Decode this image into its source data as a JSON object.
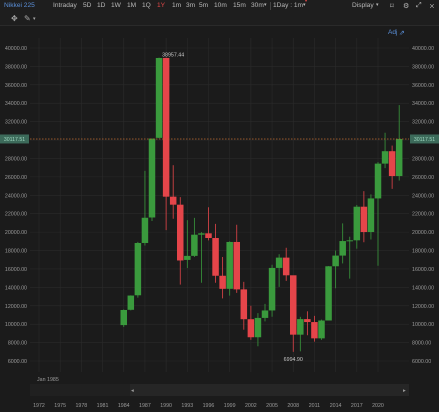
{
  "toolbar": {
    "symbol": "Nikkei 225",
    "intervals": [
      "Intraday",
      "5D",
      "1D",
      "1W",
      "1M",
      "1Q",
      "1Y",
      "1m",
      "3m",
      "5m",
      "10m",
      "15m",
      "30m"
    ],
    "active_interval": "1Y",
    "interval_dropdown": "1Day : 1m",
    "display_label": "Display",
    "adj_label": "Adj",
    "icons": [
      "dropdown-chevron-icon",
      "camera-icon",
      "settings-icon",
      "expand-icon",
      "close-icon",
      "crosshair-icon",
      "draw-icon"
    ]
  },
  "chart": {
    "colors": {
      "up": "#3a9a3d",
      "down": "#e5454a",
      "grid": "#2b2b2b",
      "bg": "#1b1b1b",
      "last_line": "#c06a30",
      "tag_bg": "#3c6a5a"
    },
    "range_label": "Jan 1985",
    "last_price_tag": "30117.51"
  },
  "chart_data": {
    "type": "candlestick",
    "title": "",
    "ylim": [
      5000,
      41500
    ],
    "yticks": [
      "40000.00",
      "38000.00",
      "36000.00",
      "34000.00",
      "32000.00",
      "30000.00",
      "28000.00",
      "26000.00",
      "24000.00",
      "22000.00",
      "20000.00",
      "18000.00",
      "16000.00",
      "14000.00",
      "12000.00",
      "10000.00",
      "8000.00",
      "6000.00"
    ],
    "xticks": [
      "1972",
      "1975",
      "1978",
      "1981",
      "1984",
      "1987",
      "1990",
      "1993",
      "1996",
      "1999",
      "2002",
      "2005",
      "2008",
      "2011",
      "2014",
      "2017",
      "2020"
    ],
    "x_axis_start": 1970,
    "x_axis_end": 2024,
    "annotations": [
      {
        "text": "38957.44",
        "year": 1989,
        "value": 38957.44
      },
      {
        "text": "6994.90",
        "year": 2008,
        "value": 6994.9
      }
    ],
    "last_price": 30117.51,
    "candles": [
      {
        "year": 1984,
        "open": 9900,
        "high": 11600,
        "low": 9700,
        "close": 11540
      },
      {
        "year": 1985,
        "open": 11560,
        "high": 13130,
        "low": 11500,
        "close": 13110
      },
      {
        "year": 1986,
        "open": 13140,
        "high": 18940,
        "low": 12880,
        "close": 18820
      },
      {
        "year": 1987,
        "open": 18820,
        "high": 26650,
        "low": 18540,
        "close": 21560
      },
      {
        "year": 1988,
        "open": 21590,
        "high": 30160,
        "low": 21210,
        "close": 30160
      },
      {
        "year": 1989,
        "open": 30240,
        "high": 38957.44,
        "low": 30180,
        "close": 38915
      },
      {
        "year": 1990,
        "open": 38920,
        "high": 38950,
        "low": 20220,
        "close": 23850
      },
      {
        "year": 1991,
        "open": 23850,
        "high": 27270,
        "low": 21450,
        "close": 22980
      },
      {
        "year": 1992,
        "open": 22980,
        "high": 23800,
        "low": 14300,
        "close": 16920
      },
      {
        "year": 1993,
        "open": 16980,
        "high": 21300,
        "low": 16100,
        "close": 17420
      },
      {
        "year": 1994,
        "open": 17420,
        "high": 21550,
        "low": 17300,
        "close": 19720
      },
      {
        "year": 1995,
        "open": 19720,
        "high": 20000,
        "low": 14500,
        "close": 19870
      },
      {
        "year": 1996,
        "open": 19870,
        "high": 22700,
        "low": 19100,
        "close": 19360
      },
      {
        "year": 1997,
        "open": 19360,
        "high": 20900,
        "low": 14500,
        "close": 15260
      },
      {
        "year": 1998,
        "open": 15260,
        "high": 17300,
        "low": 12800,
        "close": 13840
      },
      {
        "year": 1999,
        "open": 13840,
        "high": 19000,
        "low": 13100,
        "close": 18930
      },
      {
        "year": 2000,
        "open": 18930,
        "high": 20800,
        "low": 13400,
        "close": 13780
      },
      {
        "year": 2001,
        "open": 13780,
        "high": 14600,
        "low": 9400,
        "close": 10540
      },
      {
        "year": 2002,
        "open": 10540,
        "high": 12000,
        "low": 8300,
        "close": 8580
      },
      {
        "year": 2003,
        "open": 8580,
        "high": 11200,
        "low": 7600,
        "close": 10680
      },
      {
        "year": 2004,
        "open": 10680,
        "high": 12200,
        "low": 10300,
        "close": 11490
      },
      {
        "year": 2005,
        "open": 11490,
        "high": 16450,
        "low": 10800,
        "close": 16110
      },
      {
        "year": 2006,
        "open": 16110,
        "high": 17600,
        "low": 14050,
        "close": 17230
      },
      {
        "year": 2007,
        "open": 17230,
        "high": 18300,
        "low": 14700,
        "close": 15310
      },
      {
        "year": 2008,
        "open": 15310,
        "high": 15200,
        "low": 6994.9,
        "close": 8860
      },
      {
        "year": 2009,
        "open": 8860,
        "high": 10800,
        "low": 7050,
        "close": 10550
      },
      {
        "year": 2010,
        "open": 10550,
        "high": 11400,
        "low": 8800,
        "close": 10230
      },
      {
        "year": 2011,
        "open": 10230,
        "high": 10900,
        "low": 8100,
        "close": 8460
      },
      {
        "year": 2012,
        "open": 8460,
        "high": 10500,
        "low": 8300,
        "close": 10400
      },
      {
        "year": 2013,
        "open": 10400,
        "high": 16300,
        "low": 10400,
        "close": 16290
      },
      {
        "year": 2014,
        "open": 16290,
        "high": 18000,
        "low": 13900,
        "close": 17450
      },
      {
        "year": 2015,
        "open": 17450,
        "high": 20950,
        "low": 16600,
        "close": 19030
      },
      {
        "year": 2016,
        "open": 19030,
        "high": 19500,
        "low": 14950,
        "close": 19110
      },
      {
        "year": 2017,
        "open": 19110,
        "high": 22950,
        "low": 18200,
        "close": 22760
      },
      {
        "year": 2018,
        "open": 22760,
        "high": 24450,
        "low": 18900,
        "close": 20010
      },
      {
        "year": 2019,
        "open": 20010,
        "high": 24100,
        "low": 19200,
        "close": 23660
      },
      {
        "year": 2020,
        "open": 23660,
        "high": 27600,
        "low": 16350,
        "close": 27440
      },
      {
        "year": 2021,
        "open": 27440,
        "high": 30800,
        "low": 26950,
        "close": 28790
      },
      {
        "year": 2022,
        "open": 28790,
        "high": 29400,
        "low": 24700,
        "close": 26090
      },
      {
        "year": 2023,
        "open": 26090,
        "high": 33800,
        "low": 25600,
        "close": 30117.51
      }
    ]
  }
}
